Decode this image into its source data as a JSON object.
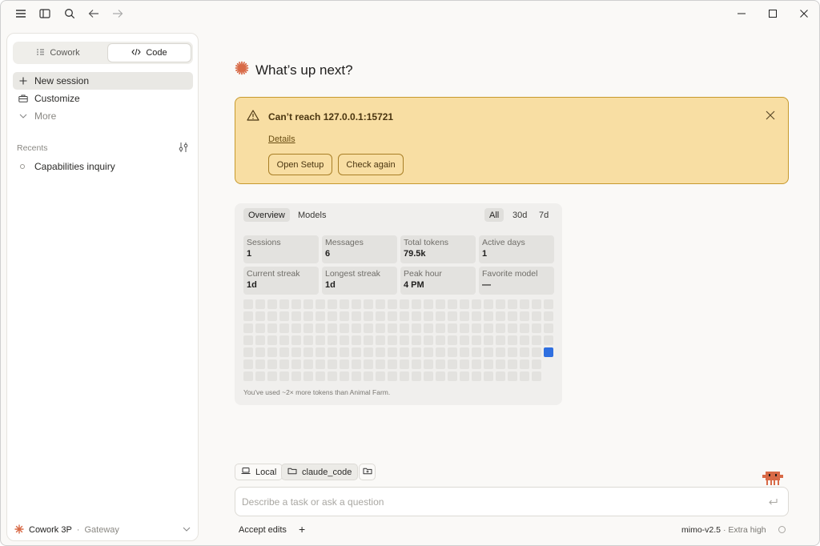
{
  "mode_switch": {
    "cowork_label": "Cowork",
    "code_label": "Code"
  },
  "sidebar": {
    "items": [
      {
        "label": "New session",
        "icon": "plus-icon"
      },
      {
        "label": "Customize",
        "icon": "briefcase-icon"
      },
      {
        "label": "More",
        "icon": "chevron-down-icon"
      }
    ],
    "recents_label": "Recents",
    "recents": [
      {
        "label": "Capabilities inquiry"
      }
    ],
    "account": {
      "name": "Cowork 3P",
      "separator": "·",
      "sub": "Gateway"
    }
  },
  "main": {
    "greeting": "What’s up next?",
    "alert": {
      "title": "Can’t reach 127.0.0.1:15721",
      "link": "Details",
      "open_setup": "Open Setup",
      "check_again": "Check again",
      "bg_color": "#f8dea3"
    },
    "stats": {
      "tabs": [
        "Overview",
        "Models"
      ],
      "ranges": [
        "All",
        "30d",
        "7d"
      ],
      "cards": [
        {
          "label": "Sessions",
          "value": "1"
        },
        {
          "label": "Messages",
          "value": "6"
        },
        {
          "label": "Total tokens",
          "value": "79.5k"
        },
        {
          "label": "Active days",
          "value": "1"
        },
        {
          "label": "Current streak",
          "value": "1d"
        },
        {
          "label": "Longest streak",
          "value": "1d"
        },
        {
          "label": "Peak hour",
          "value": "4 PM"
        },
        {
          "label": "Favorite model",
          "value": "—"
        }
      ],
      "note": "You've used ~2× more tokens than Animal Farm.",
      "active_color": "#2f6fe0"
    },
    "chips": {
      "local": "Local",
      "folder": "claude_code"
    },
    "composer": {
      "placeholder": "Describe a task or ask a question"
    },
    "footer": {
      "accept_edits": "Accept edits",
      "plus": "+",
      "model": "mimo-v2.5",
      "separator": "·",
      "effort": "Extra high"
    }
  }
}
